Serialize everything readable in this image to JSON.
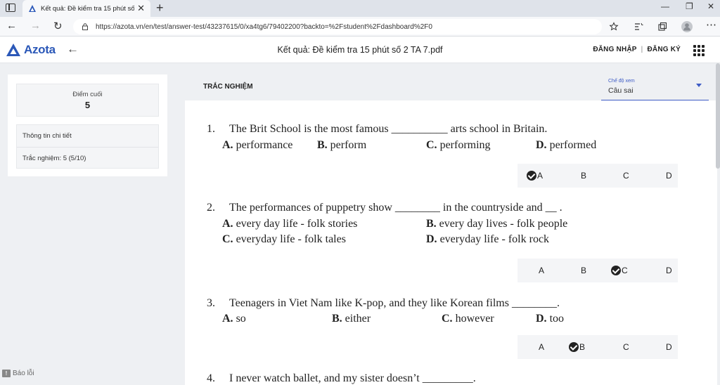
{
  "browser": {
    "tab_title": "Kết quả: Đề kiểm tra 15 phút số",
    "url": "https://azota.vn/en/test/answer-test/43237615/0/xa4tg6/79402200?backto=%2Fstudent%2Fdashboard%2F0"
  },
  "header": {
    "logo": "Azota",
    "title": "Kết quả: Đề kiểm tra 15 phút số 2 TA 7.pdf",
    "login": "ĐĂNG NHẬP",
    "separator": "|",
    "register": "ĐĂNG KÝ"
  },
  "summary": {
    "score_label": "Điểm cuối",
    "score_value": "5",
    "details_title": "Thông tin chi tiết",
    "multiple_choice": "Trắc nghiệm: 5 (5/10)"
  },
  "bug_report": "Báo lỗi",
  "section_title": "TRẮC NGHIỆM",
  "view_mode": {
    "label": "Chế độ xem",
    "value": "Câu sai"
  },
  "questions": [
    {
      "number": "1.",
      "text": "The Brit School is the most famous __________ arts school in Britain.",
      "options": [
        {
          "letter": "A.",
          "text": "performance"
        },
        {
          "letter": "B.",
          "text": "perform"
        },
        {
          "letter": "C.",
          "text": "performing"
        },
        {
          "letter": "D.",
          "text": "performed"
        }
      ],
      "selected": "A"
    },
    {
      "number": "2.",
      "text": "The performances of puppetry show ________ in the countryside and __ .",
      "options": [
        {
          "letter": "A.",
          "text": "every day life - folk stories"
        },
        {
          "letter": "B.",
          "text": "every day lives - folk people"
        },
        {
          "letter": "C.",
          "text": "everyday life - folk tales"
        },
        {
          "letter": "D.",
          "text": "everyday life - folk rock"
        }
      ],
      "selected": "C"
    },
    {
      "number": "3.",
      "text": "Teenagers in Viet Nam like K-pop, and they like Korean films ________.",
      "options": [
        {
          "letter": "A.",
          "text": "so"
        },
        {
          "letter": "B.",
          "text": "either"
        },
        {
          "letter": "C.",
          "text": "however"
        },
        {
          "letter": "D.",
          "text": "too"
        }
      ],
      "selected": "B"
    },
    {
      "number": "4.",
      "text": "I never watch ballet, and my sister doesn’t _________."
    }
  ],
  "answer_letters": [
    "A",
    "B",
    "C",
    "D"
  ]
}
